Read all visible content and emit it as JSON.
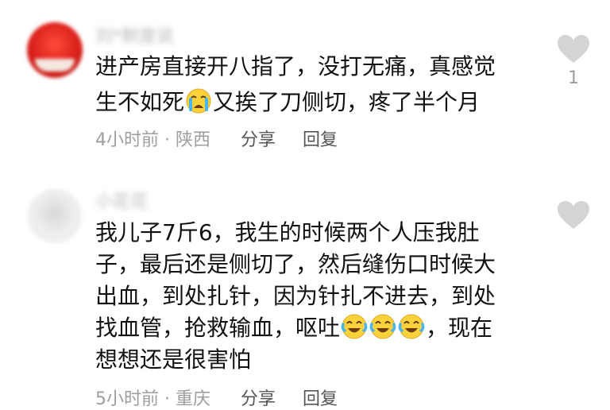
{
  "comments": [
    {
      "username": "刘*默度说",
      "line1": "进产房直接开八指了，没打无痛，真感觉",
      "line2_a": "生不如死",
      "line2_b": "又挨了刀侧切，疼了半个月",
      "time_location": "4小时前 · 陕西",
      "share": "分享",
      "reply": "回复",
      "likes": "1",
      "emoji": "crying-face-icon"
    },
    {
      "username": "小花花",
      "line1": "我儿子7斤6，我生的时候两个人压我肚",
      "line2": "子，最后还是侧切了，然后缝伤口时候大",
      "line3": "出血，到处扎针，因为针扎不进去，到处",
      "line4_a": "找血管，抢救输血，呕吐",
      "line4_b": "，现在",
      "line5": "想想还是很害怕",
      "time_location": "5小时前 · 重庆",
      "share": "分享",
      "reply": "回复",
      "emoji": "tears-of-joy-icon"
    }
  ],
  "colors": {
    "text": "#111111",
    "meta": "#9e9e9e",
    "action": "#555555",
    "heart": "#d4d4d4"
  }
}
